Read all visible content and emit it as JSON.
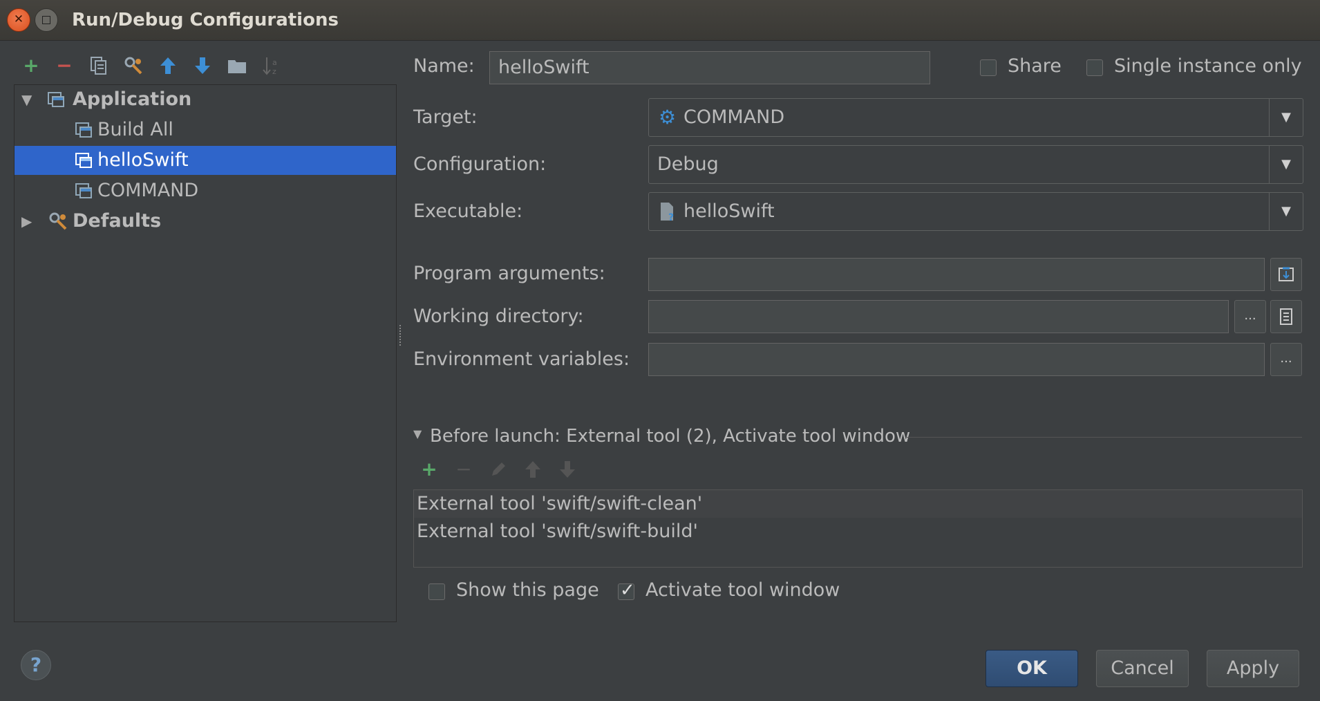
{
  "window": {
    "title": "Run/Debug Configurations"
  },
  "toolbar": {
    "icons": [
      "add-icon",
      "remove-icon",
      "copy-icon",
      "edit-defaults-icon",
      "move-up-icon",
      "move-down-icon",
      "folder-icon",
      "sort-icon"
    ]
  },
  "tree": {
    "items": [
      {
        "label": "Application",
        "expanded": true
      },
      {
        "label": "Build All"
      },
      {
        "label": "helloSwift",
        "selected": true
      },
      {
        "label": "COMMAND"
      },
      {
        "label": "Defaults",
        "expanded": false
      }
    ]
  },
  "form": {
    "name_label": "Name:",
    "name_value": "helloSwift",
    "share_label": "Share",
    "share_checked": false,
    "single_instance_label": "Single instance only",
    "single_instance_checked": false,
    "target_label": "Target:",
    "target_value": "COMMAND",
    "configuration_label": "Configuration:",
    "configuration_value": "Debug",
    "executable_label": "Executable:",
    "executable_value": "helloSwift",
    "program_arguments_label": "Program arguments:",
    "program_arguments_value": "",
    "working_directory_label": "Working directory:",
    "working_directory_value": "",
    "environment_variables_label": "Environment variables:",
    "environment_variables_value": "",
    "browse_label": "..."
  },
  "before_launch": {
    "title": "Before launch: External tool (2), Activate tool window",
    "items": [
      "External tool 'swift/swift-clean'",
      "External tool 'swift/swift-build'"
    ],
    "show_page_label": "Show this page",
    "show_page_checked": false,
    "activate_tool_label": "Activate tool window",
    "activate_tool_checked": true
  },
  "buttons": {
    "ok": "OK",
    "cancel": "Cancel",
    "apply": "Apply",
    "help": "?"
  },
  "colors": {
    "background": "#3c3f41",
    "selection": "#2f65ca",
    "primary_button": "#2f4c72",
    "add_green": "#59a869",
    "remove_red": "#c75450",
    "arrow_blue": "#3d8fd6"
  }
}
